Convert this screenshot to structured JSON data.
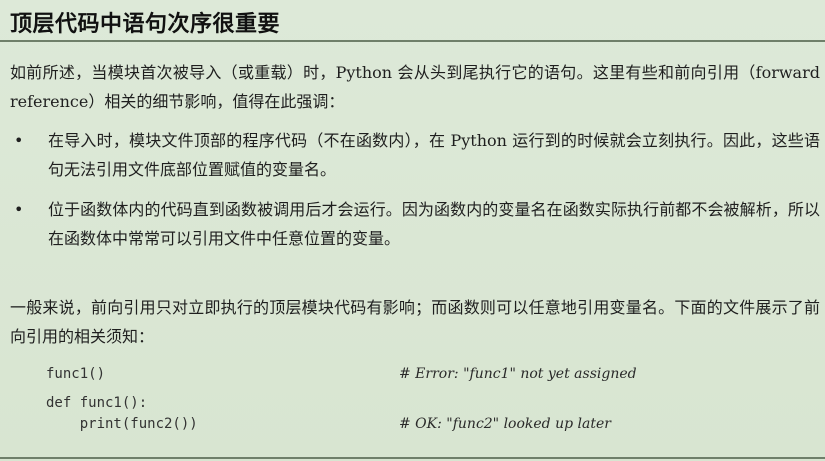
{
  "title": "顶层代码中语句次序很重要",
  "intro": "如前所述，当模块首次被导入（或重载）时，Python 会从头到尾执行它的语句。这里有些和前向引用（forward reference）相关的细节影响，值得在此强调：",
  "bullets": [
    "在导入时，模块文件顶部的程序代码（不在函数内），在 Python 运行到的时候就会立刻执行。因此，这些语句无法引用文件底部位置赋值的变量名。",
    "位于函数体内的代码直到函数被调用后才会运行。因为函数内的变量名在函数实际执行前都不会被解析，所以在函数体中常常可以引用文件中任意位置的变量。"
  ],
  "bullet_marker": "•",
  "summary": "一般来说，前向引用只对立即执行的顶层模块代码有影响；而函数则可以任意地引用变量名。下面的文件展示了前向引用的相关须知：",
  "code": [
    {
      "line": "func1()",
      "comment": "# Error: \"func1\" not yet assigned"
    },
    {
      "line": "def func1():",
      "comment": ""
    },
    {
      "line": "    print(func2())",
      "comment": "# OK: \"func2\" looked up later"
    }
  ]
}
